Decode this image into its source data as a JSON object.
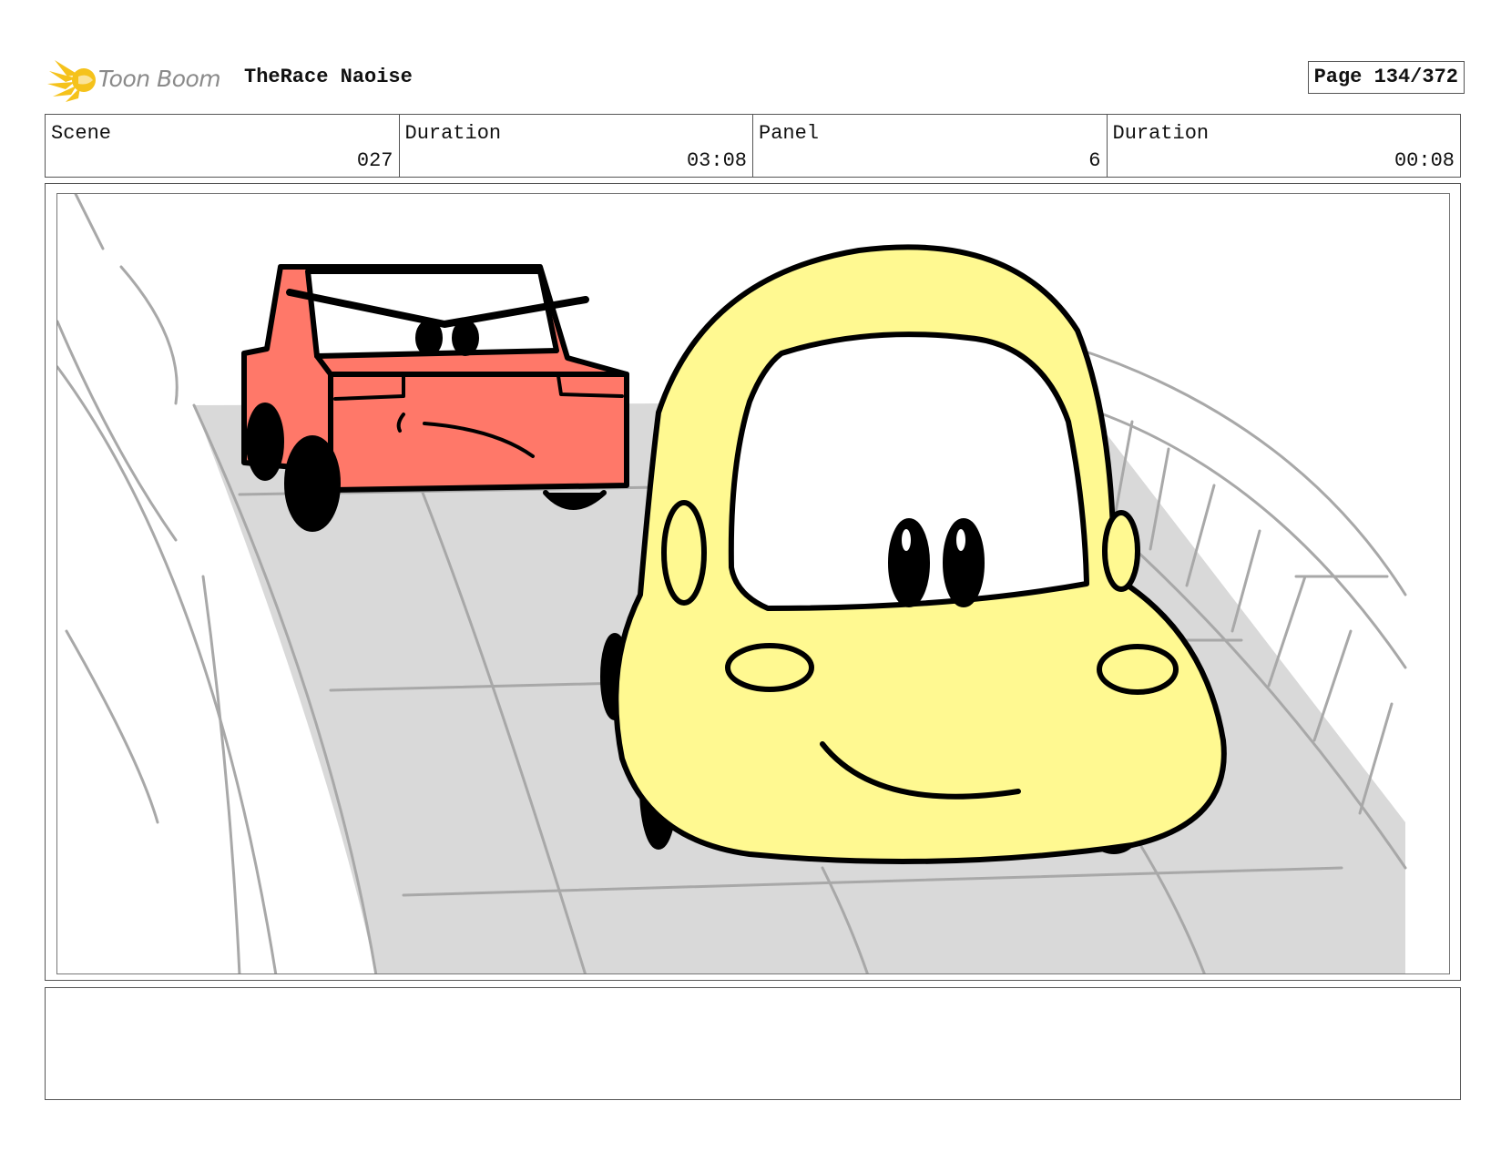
{
  "header": {
    "brand": "Toon Boom",
    "project_title": "TheRace Naoise",
    "page_counter": "Page 134/372"
  },
  "info": {
    "scene": {
      "label": "Scene",
      "value": "027"
    },
    "scene_duration": {
      "label": "Duration",
      "value": "03:08"
    },
    "panel": {
      "label": "Panel",
      "value": "6"
    },
    "panel_duration": {
      "label": "Duration",
      "value": "00:08"
    }
  },
  "panel_image": {
    "subject": "red-car-and-yellow-car-on-bridge",
    "colors": {
      "red_car": "#FF7869",
      "yellow_car": "#FFF991",
      "road": "#D9D9D9",
      "outline": "#000000",
      "sketch": "#AAAAAA"
    }
  },
  "notes": {
    "text": ""
  }
}
